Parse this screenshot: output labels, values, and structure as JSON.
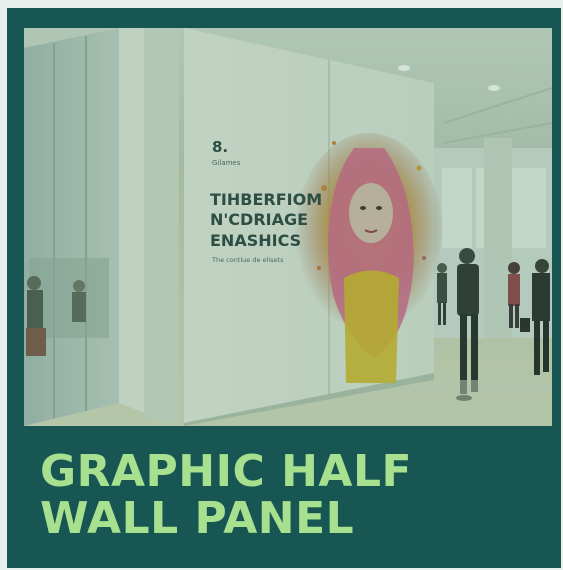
{
  "card": {
    "title_line1": "GRAPHIC HALF",
    "title_line2": "WALL PANEL"
  },
  "poster": {
    "logo_mark": "8.",
    "logo_sub": "Gilames",
    "headline_line1": "TIHBERFIOM",
    "headline_line2": "N'CDRIAGE",
    "headline_line3": "ENASHICS",
    "tagline": "The contlue de elisets"
  },
  "colors": {
    "card_background": "#175653",
    "title_text": "#a7e08f"
  }
}
